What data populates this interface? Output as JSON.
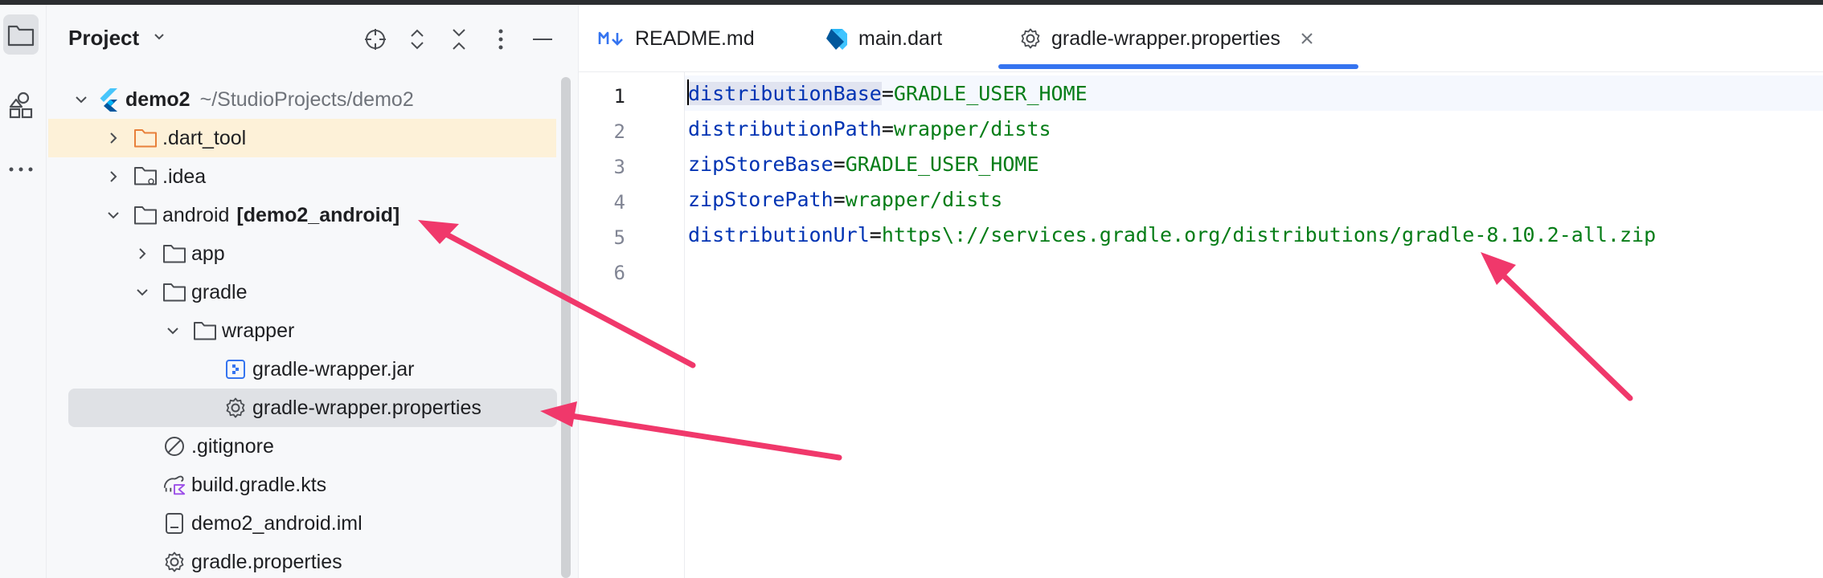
{
  "panel": {
    "title": "Project"
  },
  "tree": [
    {
      "label": "demo2",
      "suffix": "~/StudioProjects/demo2",
      "icon": "flutter-icon",
      "expanded": true,
      "depth": 0
    },
    {
      "label": ".dart_tool",
      "icon": "folder-orange-icon",
      "expanded": false,
      "depth": 1
    },
    {
      "label": ".idea",
      "icon": "folder-settings-icon",
      "expanded": false,
      "depth": 1
    },
    {
      "label": "android",
      "bold_suffix": "[demo2_android]",
      "icon": "folder-icon",
      "expanded": true,
      "depth": 1
    },
    {
      "label": "app",
      "icon": "folder-icon",
      "expanded": false,
      "depth": 2
    },
    {
      "label": "gradle",
      "icon": "folder-icon",
      "expanded": true,
      "depth": 2
    },
    {
      "label": "wrapper",
      "icon": "folder-icon",
      "expanded": true,
      "depth": 3
    },
    {
      "label": "gradle-wrapper.jar",
      "icon": "jar-icon",
      "depth": 4
    },
    {
      "label": "gradle-wrapper.properties",
      "icon": "gear-icon",
      "depth": 4,
      "selected": true
    },
    {
      "label": ".gitignore",
      "icon": "ignore-icon",
      "depth": 2
    },
    {
      "label": "build.gradle.kts",
      "icon": "gradle-kotlin-icon",
      "depth": 2
    },
    {
      "label": "demo2_android.iml",
      "icon": "iml-icon",
      "depth": 2
    },
    {
      "label": "gradle.properties",
      "icon": "gear-icon",
      "depth": 2
    }
  ],
  "tabs": [
    {
      "label": "README.md",
      "icon": "markdown-icon"
    },
    {
      "label": "main.dart",
      "icon": "dart-icon"
    },
    {
      "label": "gradle-wrapper.properties",
      "icon": "gear-icon",
      "active": true
    }
  ],
  "editor": {
    "line_numbers": [
      "1",
      "2",
      "3",
      "4",
      "5",
      "6"
    ],
    "lines": [
      {
        "key": "distributionBase",
        "eq": "=",
        "value": "GRADLE_USER_HOME"
      },
      {
        "key": "distributionPath",
        "eq": "=",
        "value": "wrapper/dists"
      },
      {
        "key": "zipStoreBase",
        "eq": "=",
        "value": "GRADLE_USER_HOME"
      },
      {
        "key": "zipStorePath",
        "eq": "=",
        "value": "wrapper/dists"
      },
      {
        "key": "distributionUrl",
        "eq": "=",
        "value": "https\\://services.gradle.org/distributions/gradle-8.10.2-all.zip"
      },
      {
        "key": "",
        "eq": "",
        "value": ""
      }
    ]
  },
  "colors": {
    "annotation_arrow": "#f0386b",
    "accent": "#3574f0",
    "key": "#0033b3",
    "value": "#067d17"
  }
}
